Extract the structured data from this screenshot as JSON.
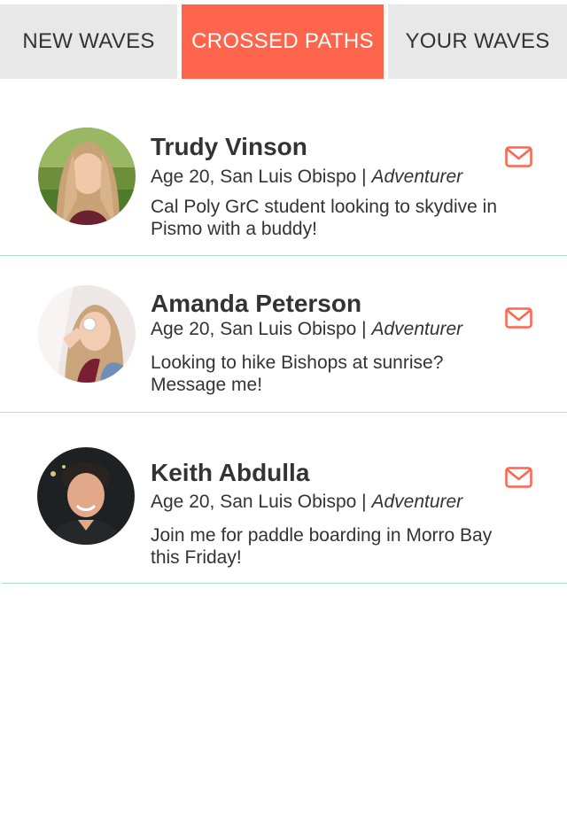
{
  "tabs": [
    {
      "label": "NEW WAVES",
      "active": false
    },
    {
      "label": "CROSSED PATHS",
      "active": true
    },
    {
      "label": "YOUR WAVES",
      "active": false
    }
  ],
  "colors": {
    "accent": "#ff644c",
    "tab_inactive_bg": "#e8e8e8",
    "divider": "#a8dcd6",
    "text": "#333333"
  },
  "people": [
    {
      "name": "Trudy Vinson",
      "age_location": "Age 20, San Luis Obispo",
      "separator": " | ",
      "tag": "Adventurer",
      "description": "Cal Poly GrC student looking to skydive in Pismo with a buddy!",
      "icon": "mail-icon"
    },
    {
      "name": "Amanda Peterson",
      "age_location": "Age 20, San Luis Obispo",
      "separator": " | ",
      "tag": "Adventurer",
      "description": "Looking to hike Bishops at sunrise? Message me!",
      "icon": "mail-icon"
    },
    {
      "name": "Keith Abdulla",
      "age_location": "Age 20, San Luis Obispo",
      "separator": " | ",
      "tag": "Adventurer",
      "description": "Join me for paddle boarding in Morro Bay this Friday!",
      "icon": "mail-icon"
    }
  ]
}
